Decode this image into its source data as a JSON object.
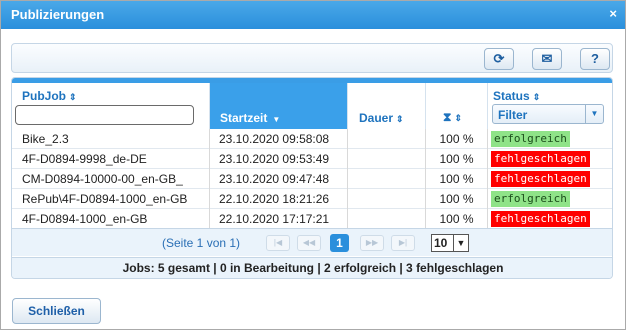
{
  "dialog": {
    "title": "Publizierungen",
    "close_glyph": "×"
  },
  "toolbar": {
    "refresh_glyph": "⟳",
    "mail_glyph": "✉",
    "help_glyph": "?"
  },
  "grid": {
    "columns": {
      "pubjob": "PubJob",
      "startzeit": "Startzeit",
      "dauer": "Dauer",
      "status": "Status",
      "sort_glyph": "⇕",
      "sort_active_glyph": "▼",
      "hourglass_glyph": "⧗"
    },
    "status_filter": {
      "value": "Filter",
      "arrow": "▼"
    },
    "rows": [
      {
        "pubjob": "Bike_2.3",
        "startzeit": "23.10.2020 09:58:08",
        "dauer": "",
        "progress": "100 %",
        "status": "erfolgreich",
        "state": "ok"
      },
      {
        "pubjob": "4F-D0894-9998_de-DE",
        "startzeit": "23.10.2020 09:53:49",
        "dauer": "",
        "progress": "100 %",
        "status": "fehlgeschlagen",
        "state": "fail"
      },
      {
        "pubjob": "CM-D0894-10000-00_en-GB_",
        "startzeit": "23.10.2020 09:47:48",
        "dauer": "",
        "progress": "100 %",
        "status": "fehlgeschlagen",
        "state": "fail"
      },
      {
        "pubjob": "RePub\\4F-D0894-1000_en-GB",
        "startzeit": "22.10.2020 18:21:26",
        "dauer": "",
        "progress": "100 %",
        "status": "erfolgreich",
        "state": "ok"
      },
      {
        "pubjob": "4F-D0894-1000_en-GB",
        "startzeit": "22.10.2020 17:17:21",
        "dauer": "",
        "progress": "100 %",
        "status": "fehlgeschlagen",
        "state": "fail"
      }
    ],
    "pager": {
      "page_info": "(Seite 1 von 1)",
      "current_page": "1",
      "page_size": "10",
      "page_size_arrow": "▼",
      "first": "|◀",
      "prev": "◀◀",
      "next": "▶▶",
      "last": "▶|"
    },
    "summary": "Jobs: 5 gesamt | 0 in Bearbeitung | 2 erfolgreich | 3 fehlgeschlagen"
  },
  "footer": {
    "close_label": "Schließen"
  },
  "colors": {
    "accent": "#2a8fdc",
    "success": "#8fe388",
    "failure": "#ff0000"
  }
}
